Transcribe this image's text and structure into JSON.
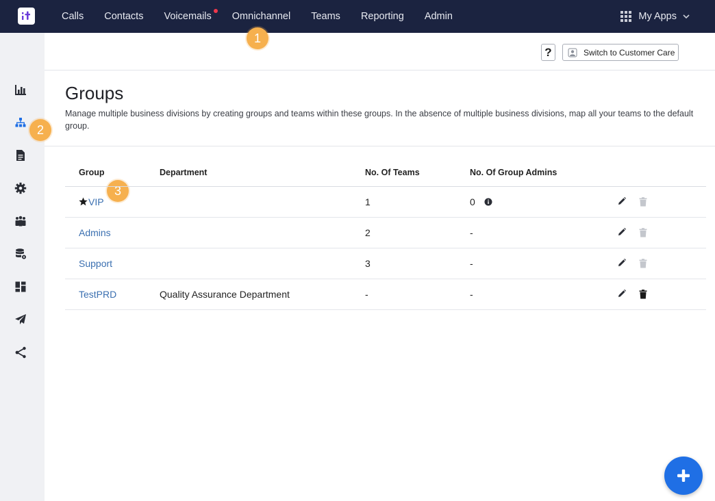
{
  "topnav": {
    "logo_icon": "tenant-logo-icon",
    "items": [
      {
        "label": "Calls",
        "has_dot": false
      },
      {
        "label": "Contacts",
        "has_dot": false
      },
      {
        "label": "Voicemails",
        "has_dot": true
      },
      {
        "label": "Omnichannel",
        "has_dot": false
      },
      {
        "label": "Teams",
        "has_dot": false
      },
      {
        "label": "Reporting",
        "has_dot": false
      },
      {
        "label": "Admin",
        "has_dot": false
      }
    ],
    "my_apps_label": "My Apps",
    "bg_color": "#1b2340",
    "notification_dot_color": "#f0384c"
  },
  "sidebar": {
    "items": [
      {
        "icon": "bar-chart-icon",
        "active": false
      },
      {
        "icon": "org-hierarchy-icon",
        "active": true
      },
      {
        "icon": "document-icon",
        "active": false
      },
      {
        "icon": "gear-icon",
        "active": false
      },
      {
        "icon": "users-group-icon",
        "active": false
      },
      {
        "icon": "database-settings-icon",
        "active": false
      },
      {
        "icon": "dashboard-icon",
        "active": false
      },
      {
        "icon": "paper-plane-icon",
        "active": false
      },
      {
        "icon": "share-nodes-icon",
        "active": false
      }
    ],
    "active_color": "#1f6fe5"
  },
  "badges": [
    "1",
    "2",
    "3"
  ],
  "header": {
    "help_label": "?",
    "switch_label": "Switch to Customer Care"
  },
  "page": {
    "title": "Groups",
    "description": "Manage multiple business divisions by creating groups and teams within these groups. In the absence of multiple business divisions, map all your teams to the default group."
  },
  "table": {
    "headers": {
      "group": "Group",
      "department": "Department",
      "teams": "No. Of Teams",
      "admins": "No. Of Group Admins"
    },
    "rows": [
      {
        "group": "VIP",
        "starred": true,
        "department": "",
        "teams": "1",
        "admins": "0",
        "admins_info": true,
        "delete_enabled": false
      },
      {
        "group": "Admins",
        "starred": false,
        "department": "",
        "teams": "2",
        "admins": "-",
        "admins_info": false,
        "delete_enabled": false
      },
      {
        "group": "Support",
        "starred": false,
        "department": "",
        "teams": "3",
        "admins": "-",
        "admins_info": false,
        "delete_enabled": false
      },
      {
        "group": "TestPRD",
        "starred": false,
        "department": "Quality Assurance Department",
        "teams": "-",
        "admins": "-",
        "admins_info": false,
        "delete_enabled": true
      }
    ],
    "link_color": "#3a6fb0"
  },
  "fab": {
    "icon": "plus-icon",
    "color": "#1f6fe5"
  },
  "badge_color": "#f6b04e"
}
